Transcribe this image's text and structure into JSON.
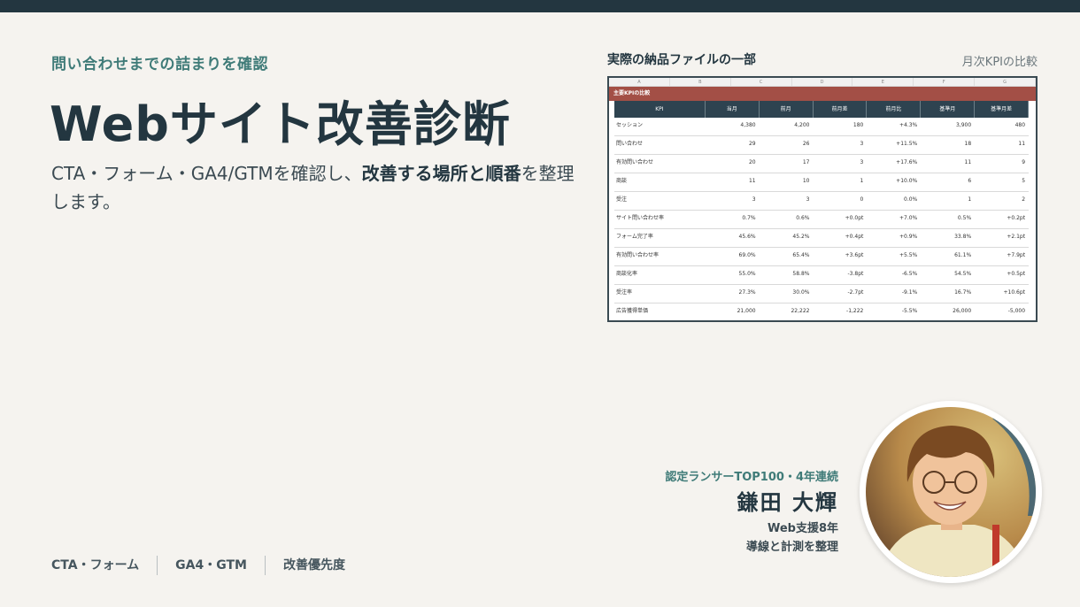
{
  "eyebrow": "問い合わせまでの詰まりを確認",
  "title": "Webサイト改善診断",
  "desc": {
    "part1": "CTA・フォーム・GA4/GTMを確認し、",
    "bold": "改善する場所と順番",
    "part2": "を整理します。"
  },
  "tags": [
    "CTA・フォーム",
    "GA4・GTM",
    "改善優先度"
  ],
  "panel": {
    "title": "実際の納品ファイルの一部",
    "subtitle": "月次KPIの比較"
  },
  "sheet": {
    "col_letters": [
      "A",
      "B",
      "C",
      "D",
      "E",
      "F",
      "G"
    ],
    "banner": "主要KPIの比較",
    "headers": [
      "KPI",
      "当月",
      "前月",
      "前月差",
      "前月比",
      "基準月",
      "基準月差"
    ],
    "rows": [
      [
        "セッション",
        "4,380",
        "4,200",
        "180",
        "+4.3%",
        "3,900",
        "480"
      ],
      [
        "問い合わせ",
        "29",
        "26",
        "3",
        "+11.5%",
        "18",
        "11"
      ],
      [
        "有効問い合わせ",
        "20",
        "17",
        "3",
        "+17.6%",
        "11",
        "9"
      ],
      [
        "商談",
        "11",
        "10",
        "1",
        "+10.0%",
        "6",
        "5"
      ],
      [
        "受注",
        "3",
        "3",
        "0",
        "0.0%",
        "1",
        "2"
      ],
      [
        "サイト問い合わせ率",
        "0.7%",
        "0.6%",
        "+0.0pt",
        "+7.0%",
        "0.5%",
        "+0.2pt"
      ],
      [
        "フォーム完了率",
        "45.6%",
        "45.2%",
        "+0.4pt",
        "+0.9%",
        "33.8%",
        "+2.1pt"
      ],
      [
        "有効問い合わせ率",
        "69.0%",
        "65.4%",
        "+3.6pt",
        "+5.5%",
        "61.1%",
        "+7.9pt"
      ],
      [
        "商談化率",
        "55.0%",
        "58.8%",
        "-3.8pt",
        "-6.5%",
        "54.5%",
        "+0.5pt"
      ],
      [
        "受注率",
        "27.3%",
        "30.0%",
        "-2.7pt",
        "-9.1%",
        "16.7%",
        "+10.6pt"
      ],
      [
        "広告獲得単価",
        "21,000",
        "22,222",
        "-1,222",
        "-5.5%",
        "26,000",
        "-5,000"
      ]
    ]
  },
  "profile": {
    "badge": "認定ランサーTOP100・4年連続",
    "name": "鎌田 大輝",
    "line1": "Web支援8年",
    "line2": "導線と計測を整理"
  },
  "colors": {
    "navy": "#233640",
    "teal": "#3f7b78",
    "brick": "#a34f46",
    "background": "#f5f3ef"
  }
}
